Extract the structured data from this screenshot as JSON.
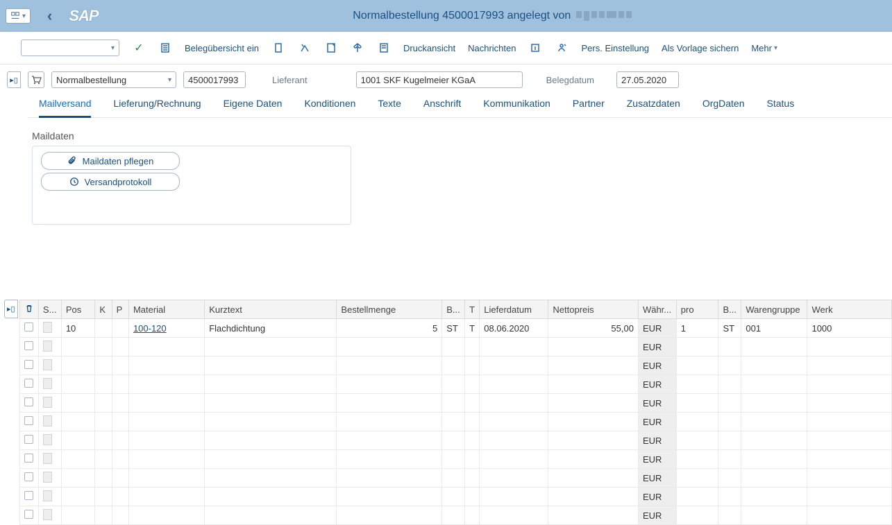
{
  "title": "Normalbestellung 4500017993 angelegt von",
  "toolbar": {
    "overview": "Belegübersicht ein",
    "print_view": "Druckansicht",
    "messages": "Nachrichten",
    "personal": "Pers. Einstellung",
    "save_template": "Als Vorlage sichern",
    "more": "Mehr"
  },
  "header": {
    "order_type": "Normalbestellung",
    "order_no": "4500017993",
    "supplier_label": "Lieferant",
    "supplier_value": "1001 SKF Kugelmeier KGaA",
    "doc_date_label": "Belegdatum",
    "doc_date_value": "27.05.2020"
  },
  "tabs": [
    "Mailversand",
    "Lieferung/Rechnung",
    "Eigene Daten",
    "Konditionen",
    "Texte",
    "Anschrift",
    "Kommunikation",
    "Partner",
    "Zusatzdaten",
    "OrgDaten",
    "Status"
  ],
  "panel": {
    "title": "Maildaten",
    "btn_maintain": "Maildaten pflegen",
    "btn_protocol": "Versandprotokoll"
  },
  "grid": {
    "cols": {
      "s": "S...",
      "pos": "Pos",
      "k": "K",
      "p": "P",
      "material": "Material",
      "kurztext": "Kurztext",
      "menge": "Bestellmenge",
      "bme": "B...",
      "t": "T",
      "lieferdatum": "Lieferdatum",
      "netto": "Nettopreis",
      "waehr": "Währ...",
      "pro": "pro",
      "bpr": "B...",
      "wg": "Warengruppe",
      "werk": "Werk"
    },
    "rows": [
      {
        "pos": "10",
        "material": "100-120",
        "kurztext": "Flachdichtung",
        "menge": "5",
        "bme": "ST",
        "t": "T",
        "lieferdatum": "08.06.2020",
        "netto": "55,00",
        "waehr": "EUR",
        "pro": "1",
        "bpr": "ST",
        "wg": "001",
        "werk": "1000"
      },
      {
        "waehr": "EUR"
      },
      {
        "waehr": "EUR"
      },
      {
        "waehr": "EUR"
      },
      {
        "waehr": "EUR"
      },
      {
        "waehr": "EUR"
      },
      {
        "waehr": "EUR"
      },
      {
        "waehr": "EUR"
      },
      {
        "waehr": "EUR"
      },
      {
        "waehr": "EUR"
      },
      {
        "waehr": "EUR"
      }
    ]
  }
}
